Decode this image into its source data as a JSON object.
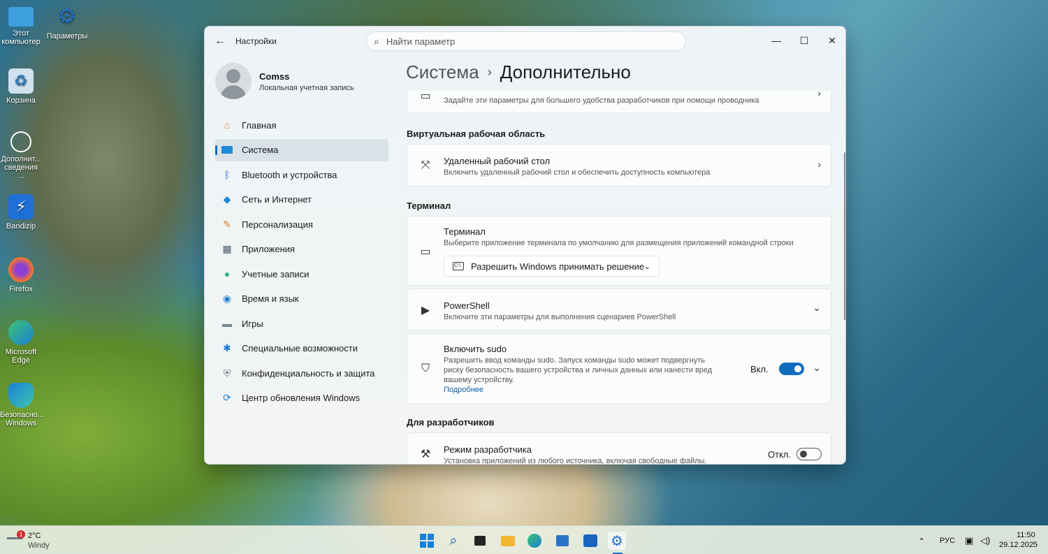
{
  "desktop": {
    "icons": [
      {
        "label": "Этот компьютер",
        "icon": "monitor-icon"
      },
      {
        "label": "Параметры",
        "icon": "settings-gear-icon"
      },
      {
        "label": "Корзина",
        "icon": "recycle-bin-icon"
      },
      {
        "label": "Дополнит... сведения ...",
        "icon": "info-circle-icon"
      },
      {
        "label": "Bandizip",
        "icon": "bandizip-icon"
      },
      {
        "label": "Firefox",
        "icon": "firefox-icon"
      },
      {
        "label": "Microsoft Edge",
        "icon": "edge-icon"
      },
      {
        "label": "Безопасно... Windows",
        "icon": "security-shield-icon"
      }
    ]
  },
  "window": {
    "app_title": "Настройки",
    "search_placeholder": "Найти параметр",
    "breadcrumb": {
      "parent": "Система",
      "separator": "›",
      "current": "Дополнительно"
    }
  },
  "profile": {
    "name": "Comss",
    "subtitle": "Локальная учетная запись"
  },
  "nav": [
    {
      "label": "Главная",
      "icon": "home-icon",
      "color": "#e07b39"
    },
    {
      "label": "Система",
      "icon": "system-display-icon",
      "color": "#1f8ad8",
      "active": true
    },
    {
      "label": "Bluetooth и устройства",
      "icon": "bluetooth-icon",
      "color": "#1f6fd0"
    },
    {
      "label": "Сеть и Интернет",
      "icon": "wifi-icon",
      "color": "#1f8ad8"
    },
    {
      "label": "Персонализация",
      "icon": "paintbrush-icon",
      "color": "#d9822b"
    },
    {
      "label": "Приложения",
      "icon": "apps-icon",
      "color": "#4a5a6a"
    },
    {
      "label": "Учетные записи",
      "icon": "accounts-icon",
      "color": "#2fb383"
    },
    {
      "label": "Время и язык",
      "icon": "globe-clock-icon",
      "color": "#2a7fc9"
    },
    {
      "label": "Игры",
      "icon": "gamepad-icon",
      "color": "#7a8794"
    },
    {
      "label": "Специальные возможности",
      "icon": "accessibility-icon",
      "color": "#1a78d6"
    },
    {
      "label": "Конфиденциальность и защита",
      "icon": "shield-icon",
      "color": "#6d7883"
    },
    {
      "label": "Центр обновления Windows",
      "icon": "update-icon",
      "color": "#1f7fd6"
    }
  ],
  "content": {
    "explorer_card": {
      "desc": "Задайте эти параметры для большего удобства разработчиков при помощи проводника"
    },
    "section_virtual": "Виртуальная рабочая область",
    "remote_desktop": {
      "title": "Удаленный рабочий стол",
      "desc": "Включить удаленный рабочий стол и обеспечить доступность компьютера"
    },
    "section_terminal": "Терминал",
    "terminal": {
      "title": "Терминал",
      "desc": "Выберите приложение терминала по умолчанию для размещения приложений командной строки",
      "dropdown_value": "Разрешить Windows принимать решение"
    },
    "powershell": {
      "title": "PowerShell",
      "desc": "Включите эти параметры для выполнения сценариев PowerShell"
    },
    "sudo": {
      "title": "Включить sudo",
      "desc": "Разрешить ввод команды sudo. Запуск команды sudo может подвергнуть риску безопасность вашего устройства и личных данных или нанести вред вашему устройству.",
      "link": "Подробнее",
      "state_label": "Вкл.",
      "on": true
    },
    "section_dev": "Для разработчиков",
    "dev_mode": {
      "title": "Режим разработчика",
      "desc": "Установка приложений из любого источника, включая свободные файлы.",
      "state_label": "Откл.",
      "on": false
    }
  },
  "taskbar": {
    "weather": {
      "temp": "2°C",
      "condition": "Windy",
      "badge": "1"
    },
    "apps": [
      "start-icon",
      "search-icon",
      "task-view-icon",
      "file-explorer-icon",
      "edge-icon",
      "store-icon",
      "outlook-icon",
      "settings-gear-icon"
    ],
    "tray": {
      "language": "РУС",
      "time": "11:50",
      "date": "29.12.2025"
    }
  }
}
